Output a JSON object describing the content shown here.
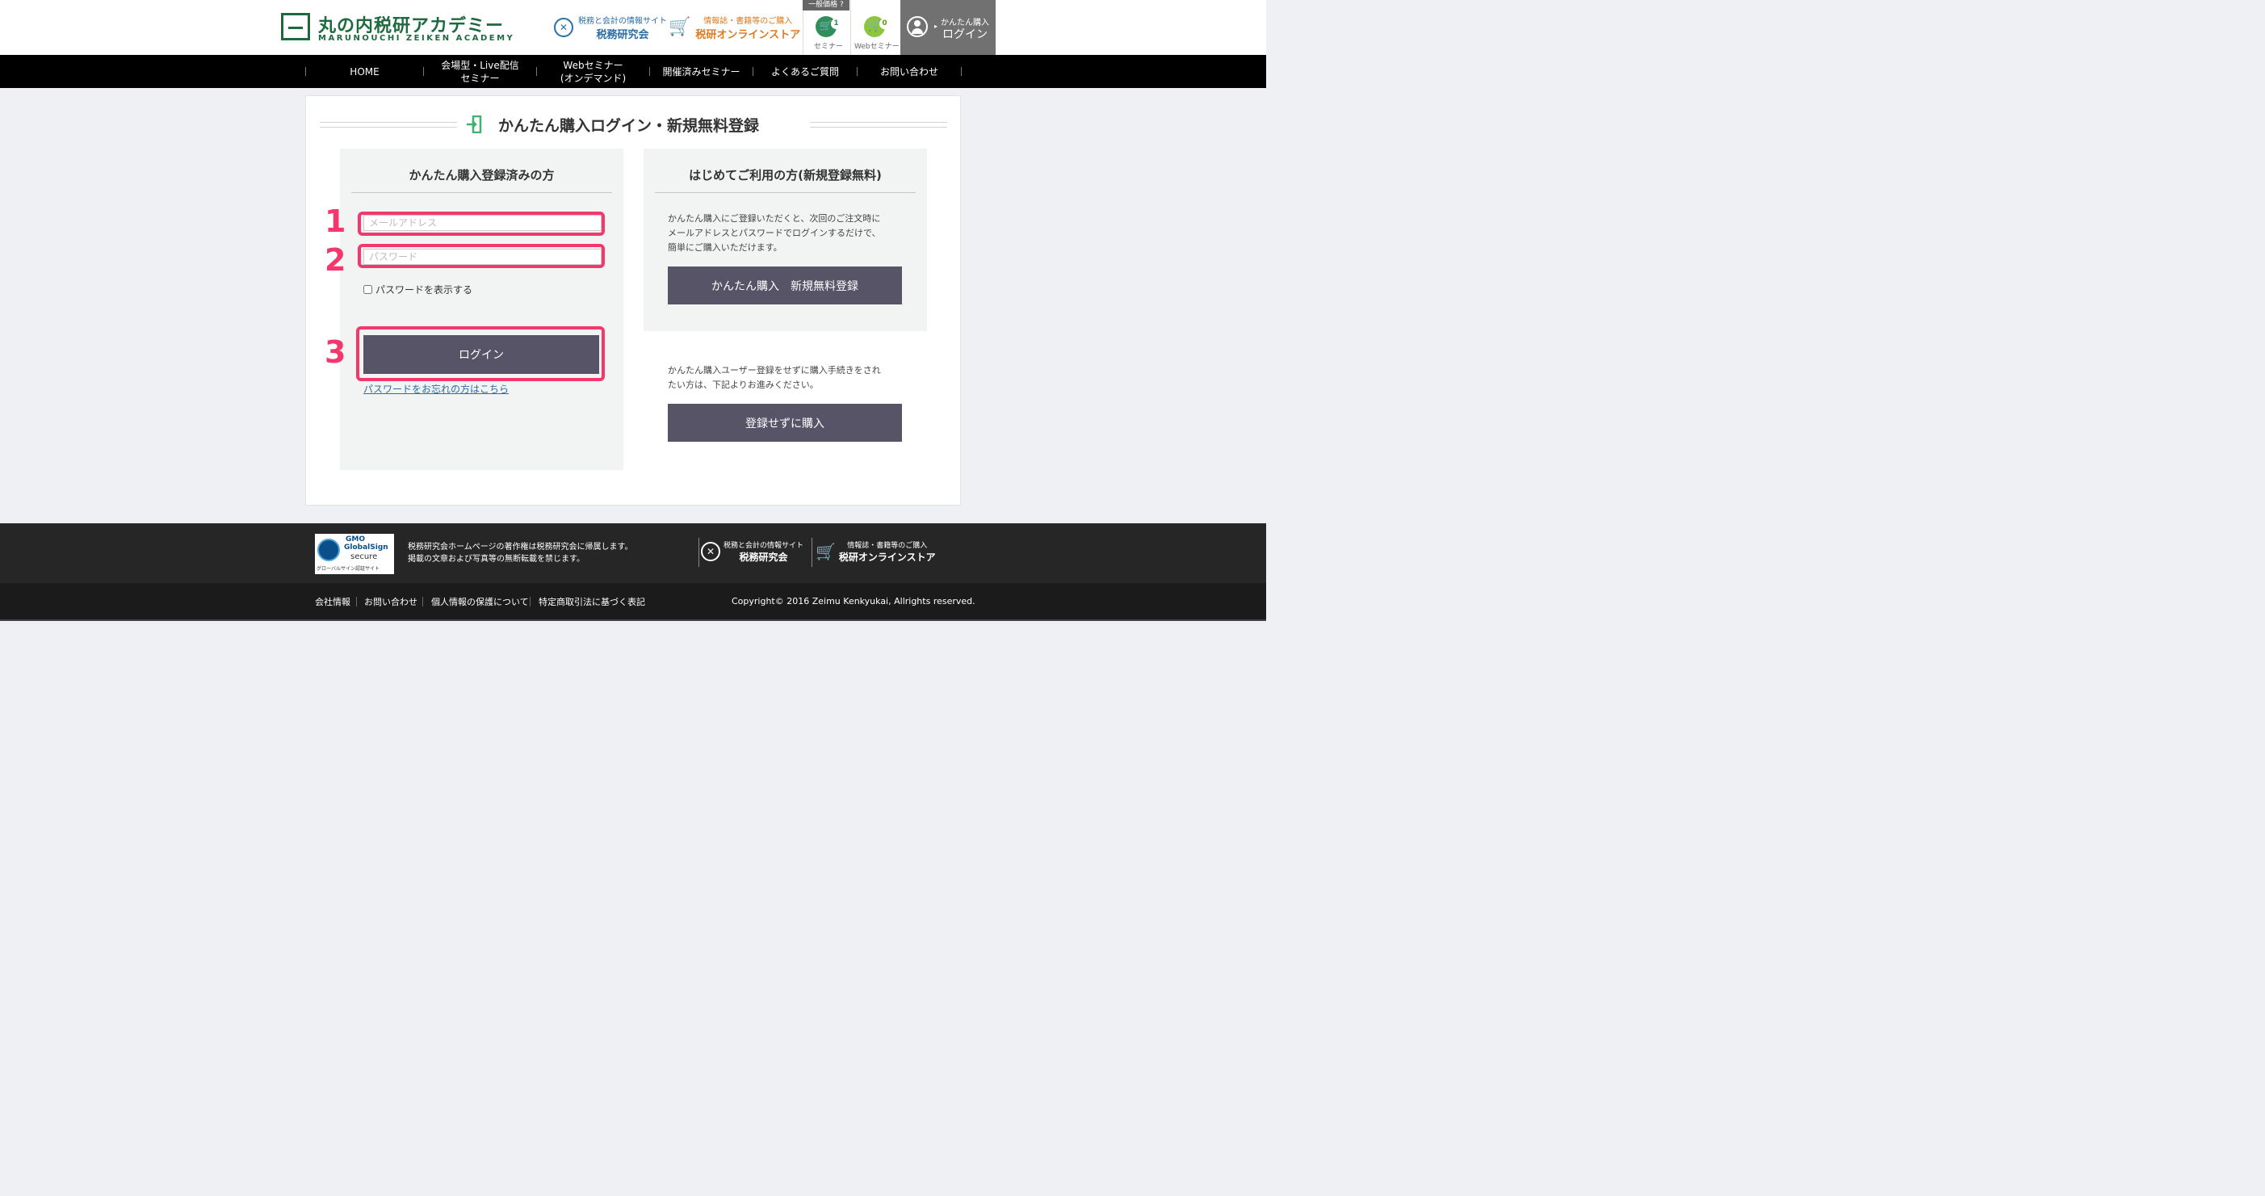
{
  "header": {
    "logo_jp": "丸の内税研アカデミー",
    "logo_en": "MARUNOUCHI ZEIKEN ACADEMY",
    "site1_small": "税務と会計の情報サイト",
    "site1_big": "税務研究会",
    "site2_small": "情報誌・書籍等のご購入",
    "site2_big": "税研オンラインストア",
    "price_tag": "一般価格",
    "seminar_label": "セミナー",
    "seminar_count": "1",
    "web_seminar_label": "Webセミナー",
    "web_seminar_count": "0",
    "login_small": "かんたん購入",
    "login_big": "ログイン",
    "colors": {
      "brand_green": "#1d6a3f",
      "store_orange": "#e07a1f",
      "site_blue": "#2a6ea8"
    }
  },
  "nav": {
    "home": "HOME",
    "venue_line1": "会場型・Live配信",
    "venue_line2": "セミナー",
    "web_line1": "Webセミナー",
    "web_line2": "(オンデマンド)",
    "past": "開催済みセミナー",
    "faq": "よくあるご質問",
    "contact": "お問い合わせ"
  },
  "main": {
    "title": "かんたん購入ログイン・新規無料登録",
    "left_panel": {
      "heading": "かんたん購入登録済みの方",
      "email_placeholder": "メールアドレス",
      "password_placeholder": "パスワード",
      "show_password_label": "パスワードを表示する",
      "login_button": "ログイン",
      "forgot_link": "パスワードをお忘れの方はこちら"
    },
    "right_panel": {
      "heading": "はじめてご利用の方(新規登録無料)",
      "desc_line1": "かんたん購入にご登録いただくと、次回のご注文時に",
      "desc_line2": "メールアドレスとパスワードでログインするだけで、",
      "desc_line3": "簡単にご購入いただけます。",
      "register_button": "かんたん購入　新規無料登録",
      "guest_line1": "かんたん購入ユーザー登録をせずに購入手続きをされ",
      "guest_line2": "たい方は、下記よりお進みください。",
      "guest_button": "登録せずに購入"
    },
    "annotations": [
      "1",
      "2",
      "3"
    ],
    "highlight_color": "#f2386c"
  },
  "footer": {
    "gs_gmo": "GMO",
    "gs_name": "GlobalSign",
    "gs_secure": "secure",
    "gs_site": "グローバルサイン認証サイト",
    "copyright_line1": "税務研究会ホームページの著作権は税務研究会に帰属します。",
    "copyright_line2": "掲載の文章および写真等の無断転載を禁じます。",
    "site1_small": "税務と会計の情報サイト",
    "site1_big": "税務研究会",
    "site2_small": "情報誌・書籍等のご購入",
    "site2_big": "税研オンラインストア",
    "links": [
      "会社情報",
      "お問い合わせ",
      "個人情報の保護について",
      "特定商取引法に基づく表記"
    ],
    "copyright": "Copyright© 2016 Zeimu Kenkyukai, Allrights reserved."
  }
}
